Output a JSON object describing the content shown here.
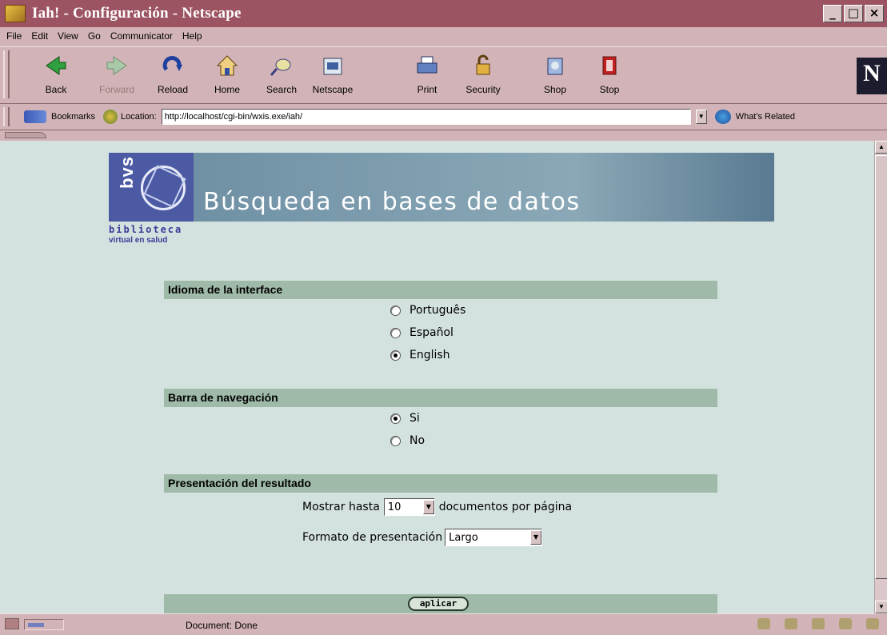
{
  "window": {
    "title": "Iah! - Configuración - Netscape"
  },
  "menubar": [
    "File",
    "Edit",
    "View",
    "Go",
    "Communicator",
    "Help"
  ],
  "toolbar": {
    "back": "Back",
    "forward": "Forward",
    "reload": "Reload",
    "home": "Home",
    "search": "Search",
    "netscape": "Netscape",
    "print": "Print",
    "security": "Security",
    "shop": "Shop",
    "stop": "Stop"
  },
  "locationbar": {
    "bookmarks": "Bookmarks",
    "location_label": "Location:",
    "url": "http://localhost/cgi-bin/wxis.exe/iah/",
    "whats_related": "What's Related"
  },
  "banner": {
    "logo_text": "bvs",
    "title": "Búsqueda en bases de datos",
    "sub1": "biblioteca",
    "sub2": "virtual en salud"
  },
  "sections": {
    "language": {
      "heading": "Idioma de la interface",
      "options": [
        {
          "label": "Português",
          "checked": false
        },
        {
          "label": "Español",
          "checked": false
        },
        {
          "label": "English",
          "checked": true
        }
      ]
    },
    "navbar": {
      "heading": "Barra de navegación",
      "options": [
        {
          "label": "Si",
          "checked": true
        },
        {
          "label": "No",
          "checked": false
        }
      ]
    },
    "results": {
      "heading": "Presentación del resultado",
      "show_prefix": "Mostrar hasta",
      "show_value": "10",
      "show_suffix": "documentos por página",
      "format_label": "Formato de presentación",
      "format_value": "Largo"
    }
  },
  "apply": {
    "label": "aplicar"
  },
  "statusbar": {
    "text": "Document: Done"
  },
  "colors": {
    "titlebar": "#9c5462",
    "chrome": "#d2b4b8",
    "content_bg": "#d3e2df",
    "section_bar": "#9fbaa8",
    "logo_blue": "#4c5aa4"
  }
}
